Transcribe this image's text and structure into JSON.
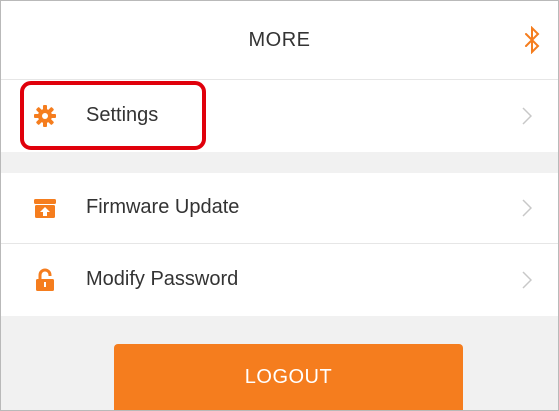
{
  "header": {
    "title": "MORE",
    "bluetooth_icon": "bluetooth-icon"
  },
  "menu": {
    "items": [
      {
        "label": "Settings",
        "icon": "gear-icon"
      },
      {
        "label": "Firmware Update",
        "icon": "firmware-update-icon"
      },
      {
        "label": "Modify Password",
        "icon": "lock-icon"
      }
    ]
  },
  "logout": {
    "label": "LOGOUT"
  },
  "colors": {
    "accent": "#f57d1e",
    "highlight": "#e0000b",
    "background": "#f1f1f1",
    "text": "#333333"
  }
}
